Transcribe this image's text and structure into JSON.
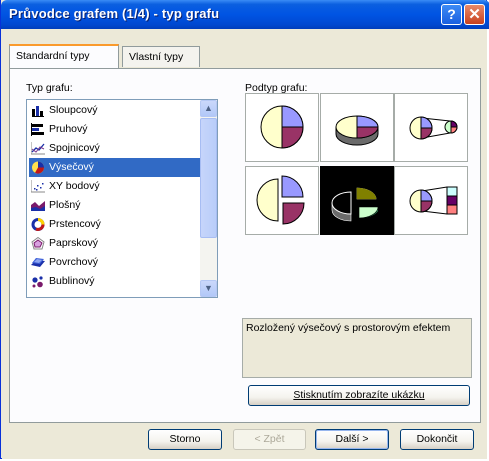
{
  "window": {
    "title": "Průvodce grafem (1/4) - typ grafu",
    "help_glyph": "?",
    "close_glyph": "✕"
  },
  "tabs": [
    {
      "label": "Standardní typy",
      "active": true
    },
    {
      "label": "Vlastní typy",
      "active": false
    }
  ],
  "chart_type_label": "Typ grafu:",
  "chart_types": [
    {
      "label": "Sloupcový",
      "icon": "column-chart-icon"
    },
    {
      "label": "Pruhový",
      "icon": "bar-chart-icon"
    },
    {
      "label": "Spojnicový",
      "icon": "line-chart-icon"
    },
    {
      "label": "Výsečový",
      "icon": "pie-chart-icon",
      "selected": true
    },
    {
      "label": "XY bodový",
      "icon": "scatter-chart-icon"
    },
    {
      "label": "Plošný",
      "icon": "area-chart-icon"
    },
    {
      "label": "Prstencový",
      "icon": "doughnut-chart-icon"
    },
    {
      "label": "Paprskový",
      "icon": "radar-chart-icon"
    },
    {
      "label": "Povrchový",
      "icon": "surface-chart-icon"
    },
    {
      "label": "Bublinový",
      "icon": "bubble-chart-icon"
    }
  ],
  "subtype_label": "Podtyp grafu:",
  "subtypes": [
    {
      "name": "pie",
      "selected": false
    },
    {
      "name": "pie-3d",
      "selected": false
    },
    {
      "name": "pie-of-pie",
      "selected": false
    },
    {
      "name": "exploded-pie",
      "selected": false
    },
    {
      "name": "exploded-pie-3d",
      "selected": true
    },
    {
      "name": "bar-of-pie",
      "selected": false
    }
  ],
  "description": "Rozložený výsečový s prostorovým efektem",
  "preview_button": "Stisknutím zobrazíte ukázku",
  "footer": {
    "cancel": "Storno",
    "back": "< Zpět",
    "next": "Další >",
    "finish": "Dokončit"
  },
  "colors": {
    "pie_blue": "#9999ff",
    "pie_purple": "#993366",
    "pie_cream": "#ffffcc",
    "pie_green": "#ccffcc",
    "pie_yellow": "#ccffff",
    "selection": "#316ac5"
  }
}
